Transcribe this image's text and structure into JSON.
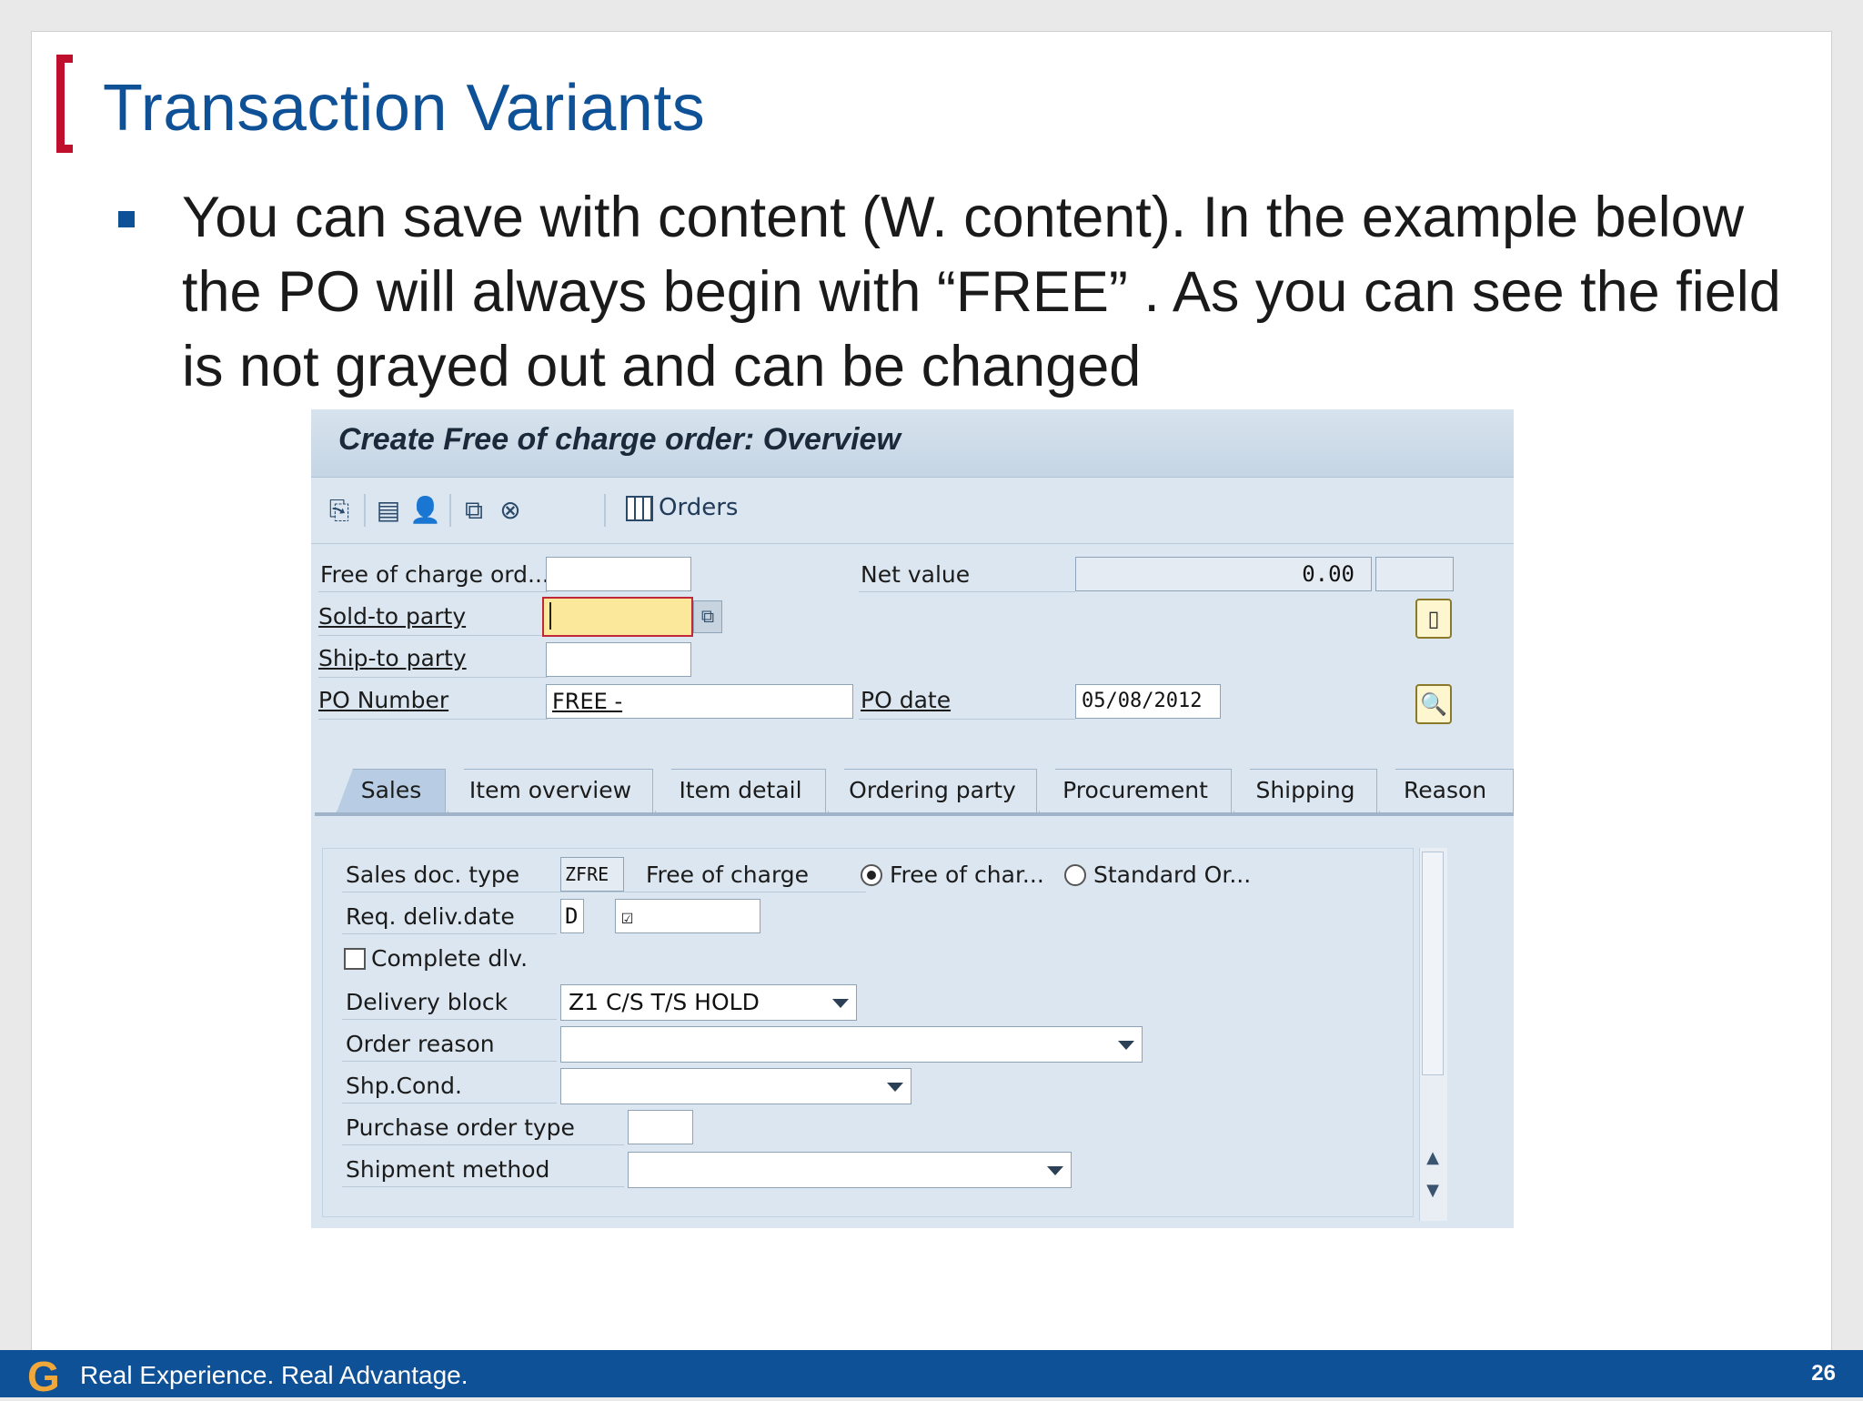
{
  "slide": {
    "title": "Transaction Variants",
    "bullet": "You can save with content (W. content).  In the example below the PO will always begin with “FREE” .  As you can see the field is not grayed out and can be changed",
    "footer_logo": "G",
    "footer_text": "Real Experience. Real Advantage.",
    "page_number": "26"
  },
  "sap": {
    "window_title": "Create Free of charge order: Overview",
    "toolbar": {
      "orders_label": "Orders"
    },
    "header": {
      "free_of_charge_label": "Free of charge ord...",
      "free_of_charge_value": "",
      "sold_to_label": "Sold-to party",
      "sold_to_value": "",
      "ship_to_label": "Ship-to party",
      "ship_to_value": "",
      "po_number_label": "PO Number",
      "po_number_value": "FREE -",
      "net_value_label": "Net value",
      "net_value": "0.00",
      "currency_value": "",
      "po_date_label": "PO date",
      "po_date_value": "05/08/2012"
    },
    "tabs": [
      "Sales",
      "Item overview",
      "Item detail",
      "Ordering party",
      "Procurement",
      "Shipping",
      "Reason fo"
    ],
    "active_tab": "Sales",
    "sales": {
      "sales_doc_type_label": "Sales doc. type",
      "sales_doc_type_value": "ZFRE",
      "sales_doc_type_desc": "Free of charge",
      "radio_free": "Free of char...",
      "radio_standard": "Standard Or...",
      "req_deliv_label": "Req. deliv.date",
      "req_deliv_unit": "D",
      "req_deliv_value": "",
      "complete_dlv_label": "Complete dlv.",
      "delivery_block_label": "Delivery block",
      "delivery_block_value": "Z1 C/S T/S HOLD",
      "order_reason_label": "Order reason",
      "order_reason_value": "",
      "shp_cond_label": "Shp.Cond.",
      "shp_cond_value": "",
      "po_type_label": "Purchase order type",
      "po_type_value": "",
      "shipment_method_label": "Shipment method",
      "shipment_method_value": ""
    }
  },
  "colors": {
    "brand_blue": "#0f5196",
    "accent_red": "#c00f2d",
    "logo_orange": "#f0a83a",
    "sap_bg": "#dbe6f0",
    "required_field": "#fbe89a"
  }
}
